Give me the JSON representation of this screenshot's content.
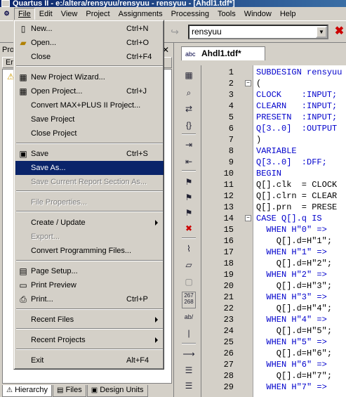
{
  "window": {
    "title": "Quartus II - e:/altera/rensyuu/rensyuu - rensyuu - [Ahdl1.tdf*]"
  },
  "menubar": {
    "items": [
      {
        "label": "File"
      },
      {
        "label": "Edit"
      },
      {
        "label": "View"
      },
      {
        "label": "Project"
      },
      {
        "label": "Assignments"
      },
      {
        "label": "Processing"
      },
      {
        "label": "Tools"
      },
      {
        "label": "Window"
      },
      {
        "label": "Help"
      }
    ]
  },
  "toolbar": {
    "project_combo_value": "rensyuu"
  },
  "file_menu": {
    "items": [
      {
        "label": "New...",
        "shortcut": "Ctrl+N",
        "icon": "new-document-icon"
      },
      {
        "label": "Open...",
        "shortcut": "Ctrl+O",
        "icon": "open-folder-icon"
      },
      {
        "label": "Close",
        "shortcut": "Ctrl+F4"
      },
      {
        "label": "New Project Wizard...",
        "icon": "wizard-icon"
      },
      {
        "label": "Open Project...",
        "shortcut": "Ctrl+J",
        "icon": "open-project-icon"
      },
      {
        "label": "Convert MAX+PLUS II Project..."
      },
      {
        "label": "Save Project"
      },
      {
        "label": "Close Project"
      },
      {
        "label": "Save",
        "shortcut": "Ctrl+S",
        "icon": "floppy-disk-icon"
      },
      {
        "label": "Save As..."
      },
      {
        "label": "Save Current Report Section As..."
      },
      {
        "label": "File Properties..."
      },
      {
        "label": "Create / Update"
      },
      {
        "label": "Export..."
      },
      {
        "label": "Convert Programming Files..."
      },
      {
        "label": "Page Setup...",
        "icon": "page-setup-icon"
      },
      {
        "label": "Print Preview",
        "icon": "print-preview-icon"
      },
      {
        "label": "Print...",
        "shortcut": "Ctrl+P",
        "icon": "printer-icon"
      },
      {
        "label": "Recent Files"
      },
      {
        "label": "Recent Projects"
      },
      {
        "label": "Exit",
        "shortcut": "Alt+F4"
      }
    ]
  },
  "navigator": {
    "header": "Pro",
    "column_header": "En",
    "tabs": [
      {
        "label": "Hierarchy"
      },
      {
        "label": "Files"
      },
      {
        "label": "Design Units"
      }
    ]
  },
  "editor": {
    "tab_icon_text": "abc",
    "tab_label": "Ahdl1.tdf*",
    "toolbar_line_text": "267\n268",
    "toolbar_ab_text": "ab/",
    "lines": [
      {
        "num": "1",
        "text": "SUBDESIGN rensyuu"
      },
      {
        "num": "2",
        "text": "("
      },
      {
        "num": "3",
        "text": "CLOCK    :INPUT;"
      },
      {
        "num": "4",
        "text": "CLEARN   :INPUT;"
      },
      {
        "num": "5",
        "text": "PRESETN  :INPUT;"
      },
      {
        "num": "6",
        "text": "Q[3..0]  :OUTPUT"
      },
      {
        "num": "7",
        "text": ")"
      },
      {
        "num": "8",
        "text": "VARIABLE"
      },
      {
        "num": "9",
        "text": "Q[3..0]  :DFF;"
      },
      {
        "num": "10",
        "text": "BEGIN"
      },
      {
        "num": "11",
        "text": "Q[].clk  = CLOCK"
      },
      {
        "num": "12",
        "text": "Q[].clrn = CLEAR"
      },
      {
        "num": "13",
        "text": "Q[].prn  = PRESE"
      },
      {
        "num": "14",
        "text": "CASE Q[].q IS"
      },
      {
        "num": "15",
        "text": "  WHEN H\"0\" =>"
      },
      {
        "num": "16",
        "text": "    Q[].d=H\"1\";"
      },
      {
        "num": "17",
        "text": "  WHEN H\"1\" =>"
      },
      {
        "num": "18",
        "text": "    Q[].d=H\"2\";"
      },
      {
        "num": "19",
        "text": "  WHEN H\"2\" =>"
      },
      {
        "num": "20",
        "text": "    Q[].d=H\"3\";"
      },
      {
        "num": "21",
        "text": "  WHEN H\"3\" =>"
      },
      {
        "num": "22",
        "text": "    Q[].d=H\"4\";"
      },
      {
        "num": "23",
        "text": "  WHEN H\"4\" =>"
      },
      {
        "num": "24",
        "text": "    Q[].d=H\"5\";"
      },
      {
        "num": "25",
        "text": "  WHEN H\"5\" =>"
      },
      {
        "num": "26",
        "text": "    Q[].d=H\"6\";"
      },
      {
        "num": "27",
        "text": "  WHEN H\"6\" =>"
      },
      {
        "num": "28",
        "text": "    Q[].d=H\"7\";"
      },
      {
        "num": "29",
        "text": "  WHEN H\"7\" =>"
      }
    ]
  },
  "colors": {
    "highlight": "#0a246a",
    "keyword": "#0000cc",
    "chrome": "#d4d0c8"
  }
}
